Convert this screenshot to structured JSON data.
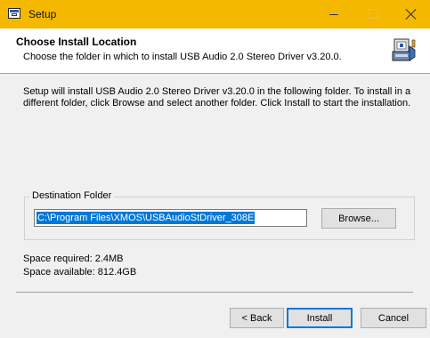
{
  "window": {
    "title": "Setup"
  },
  "header": {
    "title": "Choose Install Location",
    "subtitle": "Choose the folder in which to install USB Audio 2.0 Stereo Driver v3.20.0."
  },
  "body": {
    "description": "Setup will install USB Audio 2.0 Stereo Driver v3.20.0 in the following folder. To install in a different folder, click Browse and select another folder. Click Install to start the installation."
  },
  "destination": {
    "label": "Destination Folder",
    "path": "C:\\Program Files\\XMOS\\USBAudioStDriver_308E",
    "browse_label": "Browse..."
  },
  "space": {
    "required": "Space required: 2.4MB",
    "available": "Space available: 812.4GB"
  },
  "buttons": {
    "back": "< Back",
    "install": "Install",
    "cancel": "Cancel"
  },
  "colors": {
    "titlebar": "#f5b800",
    "selection": "#0078d7"
  },
  "icons": [
    "app-icon",
    "minimize-icon",
    "maximize-icon",
    "close-icon",
    "installer-icon"
  ]
}
